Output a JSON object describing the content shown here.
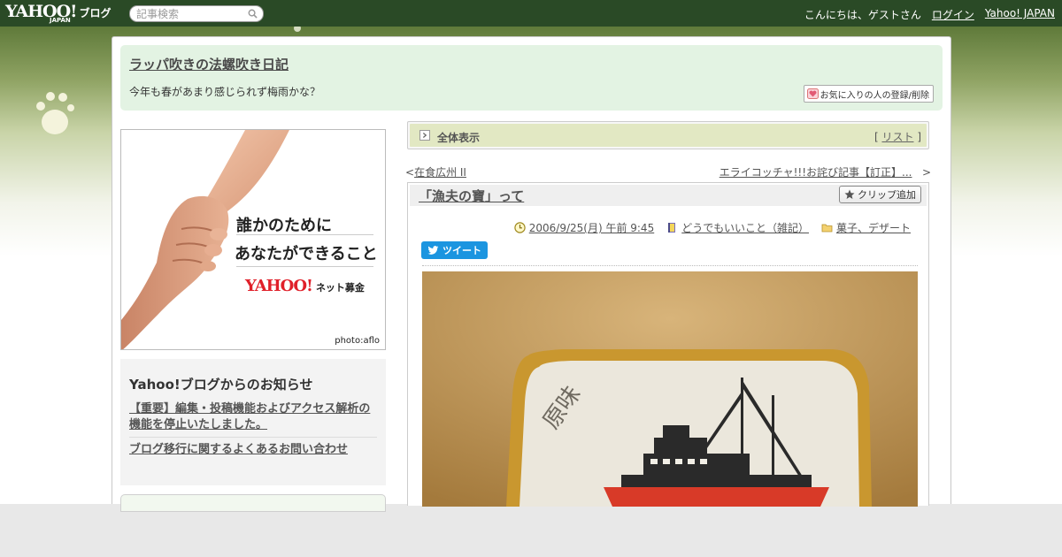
{
  "topbar": {
    "logo_text": "YAHOO!",
    "logo_sub": "JAPAN",
    "logo_service": "ブログ",
    "search_placeholder": "記事検索",
    "greeting": "こんにちは、ゲストさん",
    "login_label": "ログイン",
    "yahoo_japan_label": "Yahoo! JAPAN"
  },
  "header": {
    "blog_title": "ラッパ吹きの法螺吹き日記",
    "blog_description": "今年も春があまり感じられず梅雨かな？",
    "fav_button_label": "お気に入りの人の登録/削除"
  },
  "ad": {
    "line1": "誰かのために",
    "line2": "あなたができること",
    "logo_text": "YAHOO!",
    "logo_sub": "JAPAN",
    "logo_service": "ネット募金",
    "credit": "photo:aflo"
  },
  "notice": {
    "title": "Yahoo!ブログからのお知らせ",
    "items": [
      "【重要】編集・投稿機能およびアクセス解析の機能を停止いたしました。",
      "ブログ移行に関するよくあるお問い合わせ"
    ]
  },
  "all_view": {
    "label": "全体表示",
    "list_bracket_open": "[",
    "list_link": "リスト",
    "list_bracket_close": "]"
  },
  "pager": {
    "prev_arrow": "<",
    "prev_link": "在食広州 II",
    "next_link": "エライコッチャ!!!お詫び記事【訂正】...",
    "next_arrow": ">"
  },
  "entry": {
    "title": "「漁夫の寶」って",
    "clip_button_label": "クリップ追加",
    "date": "2006/9/25(月) 午前 9:45",
    "category": "どうでもいいこと（雑記）",
    "folder": "菓子、デザート",
    "tweet_label": "ツイート",
    "photo_text": "原味"
  },
  "colors": {
    "topbar_bg": "#2a4a26",
    "header_bg": "#e3f3e3",
    "all_view_bg": "#e2e8c3",
    "tweet_blue": "#1b95e0",
    "yahoo_red": "#e0202a"
  }
}
